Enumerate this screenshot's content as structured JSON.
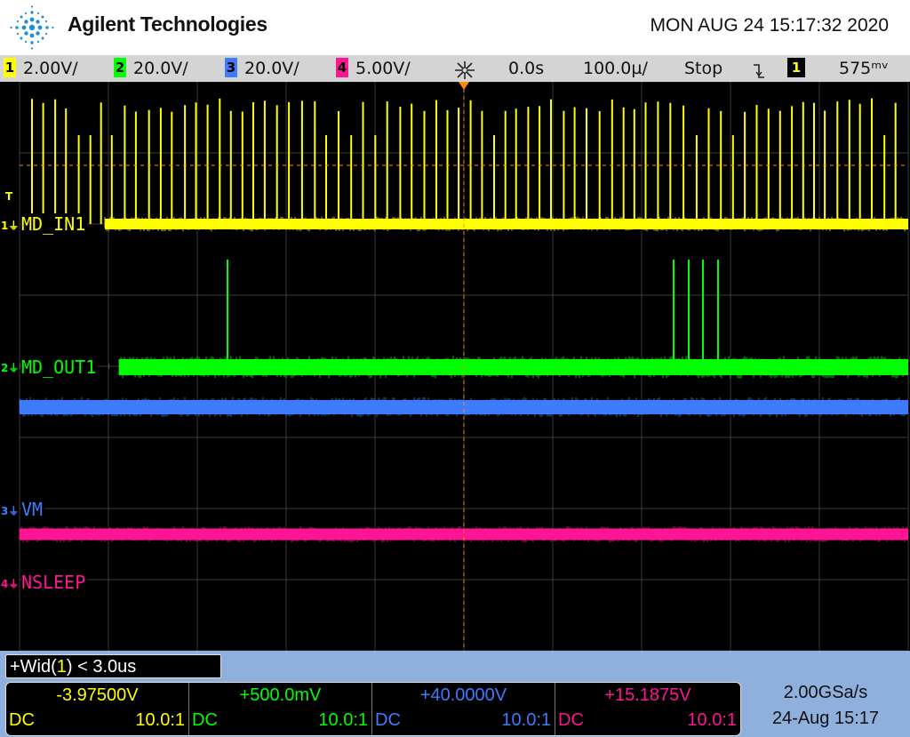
{
  "header": {
    "brand": "Agilent Technologies",
    "datetime": "MON AUG 24 15:17:32 2020"
  },
  "status_bar": {
    "channels": [
      {
        "number": "1",
        "scale": "2.00V/",
        "color": "#ffff00"
      },
      {
        "number": "2",
        "scale": "20.0V/",
        "color": "#00ff00"
      },
      {
        "number": "3",
        "scale": "20.0V/",
        "color": "#3d7bff"
      },
      {
        "number": "4",
        "scale": "5.00V/",
        "color": "#ff1493"
      }
    ],
    "delay": "0.0s",
    "timebase": "100.0µ/",
    "run_state": "Stop",
    "trigger_edge_icon": "falling-edge-icon",
    "trigger_source": "1",
    "trigger_level": "575ᵐᵛ"
  },
  "traces": [
    {
      "channel": "1",
      "label": "MD_IN1",
      "color": "#ffff00"
    },
    {
      "channel": "2",
      "label": "MD_OUT1",
      "color": "#00ff00"
    },
    {
      "channel": "3",
      "label": "VM",
      "color": "#3d7bff"
    },
    {
      "channel": "4",
      "label": "NSLEEP",
      "color": "#ff1493"
    }
  ],
  "trigger_marker": "T",
  "measurement": {
    "prefix": "+Wid(",
    "source": "1",
    "suffix": ") < 3.0us"
  },
  "channel_panel": [
    {
      "value": "-3.97500V",
      "coupling": "DC",
      "probe": "10.0:1",
      "color": "#ffff00"
    },
    {
      "value": "+500.0mV",
      "coupling": "DC",
      "probe": "10.0:1",
      "color": "#00ff00"
    },
    {
      "value": "+40.0000V",
      "coupling": "DC",
      "probe": "10.0:1",
      "color": "#3d7bff"
    },
    {
      "value": "+15.1875V",
      "coupling": "DC",
      "probe": "10.0:1",
      "color": "#ff1493"
    }
  ],
  "acquisition": {
    "sample_rate": "2.00GSa/s",
    "date": "24-Aug 15:17"
  }
}
